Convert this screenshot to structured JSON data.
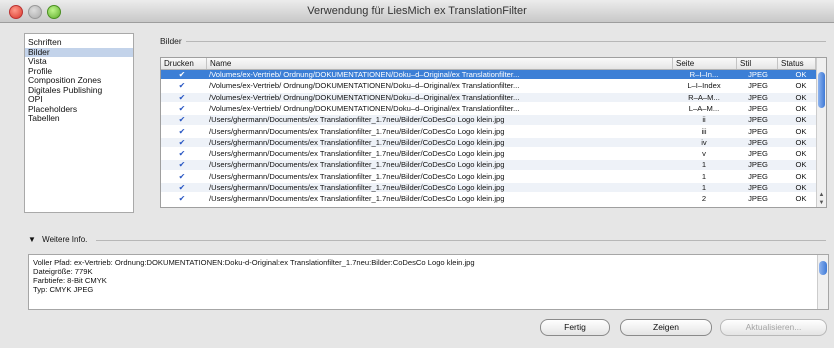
{
  "window": {
    "title": "Verwendung für LiesMich ex TranslationFilter"
  },
  "sidebar": {
    "items": [
      "Schriften",
      "Bilder",
      "Vista",
      "Profile",
      "Composition Zones",
      "Digitales Publishing",
      "OPI",
      "Placeholders",
      "Tabellen"
    ],
    "selected_index": 1
  },
  "images_section": {
    "label": "Bilder"
  },
  "table": {
    "columns": {
      "print": "Drucken",
      "name": "Name",
      "seite": "Seite",
      "stil": "Stil",
      "status": "Status"
    },
    "selected_row": 0,
    "rows": [
      {
        "name": "/Volumes/ex-Vertrieb/  Ordnung/DOKUMENTATIONEN/Doku–d–Original/ex Translationfilter...",
        "seite": "R–I–In...",
        "stil": "JPEG",
        "status": "OK"
      },
      {
        "name": "/Volumes/ex-Vertrieb/  Ordnung/DOKUMENTATIONEN/Doku–d–Original/ex Translationfilter...",
        "seite": "L–I–Index",
        "stil": "JPEG",
        "status": "OK"
      },
      {
        "name": "/Volumes/ex-Vertrieb/  Ordnung/DOKUMENTATIONEN/Doku–d–Original/ex Translationfilter...",
        "seite": "R–A–M...",
        "stil": "JPEG",
        "status": "OK"
      },
      {
        "name": "/Volumes/ex-Vertrieb/  Ordnung/DOKUMENTATIONEN/Doku–d–Original/ex Translationfilter...",
        "seite": "L–A–M...",
        "stil": "JPEG",
        "status": "OK"
      },
      {
        "name": "/Users/ghermann/Documents/ex Translationfilter_1.7neu/Bilder/CoDesCo Logo klein.jpg",
        "seite": "ii",
        "stil": "JPEG",
        "status": "OK"
      },
      {
        "name": "/Users/ghermann/Documents/ex Translationfilter_1.7neu/Bilder/CoDesCo Logo klein.jpg",
        "seite": "iii",
        "stil": "JPEG",
        "status": "OK"
      },
      {
        "name": "/Users/ghermann/Documents/ex Translationfilter_1.7neu/Bilder/CoDesCo Logo klein.jpg",
        "seite": "iv",
        "stil": "JPEG",
        "status": "OK"
      },
      {
        "name": "/Users/ghermann/Documents/ex Translationfilter_1.7neu/Bilder/CoDesCo Logo klein.jpg",
        "seite": "v",
        "stil": "JPEG",
        "status": "OK"
      },
      {
        "name": "/Users/ghermann/Documents/ex Translationfilter_1.7neu/Bilder/CoDesCo Logo klein.jpg",
        "seite": "1",
        "stil": "JPEG",
        "status": "OK"
      },
      {
        "name": "/Users/ghermann/Documents/ex Translationfilter_1.7neu/Bilder/CoDesCo Logo klein.jpg",
        "seite": "1",
        "stil": "JPEG",
        "status": "OK"
      },
      {
        "name": "/Users/ghermann/Documents/ex Translationfilter_1.7neu/Bilder/CoDesCo Logo klein.jpg",
        "seite": "1",
        "stil": "JPEG",
        "status": "OK"
      },
      {
        "name": "/Users/ghermann/Documents/ex Translationfilter_1.7neu/Bilder/CoDesCo Logo klein.jpg",
        "seite": "2",
        "stil": "JPEG",
        "status": "OK"
      }
    ]
  },
  "more_info": {
    "label": "Weitere Info.",
    "lines": [
      "Voller Pfad: ex-Vertrieb:  Ordnung:DOKUMENTATIONEN:Doku-d-Original:ex Translationfilter_1.7neu:Bilder:CoDesCo Logo klein.jpg",
      "Dateigröße: 779K",
      "Farbtiefe: 8-Bit CMYK",
      "Typ: CMYK JPEG"
    ]
  },
  "buttons": {
    "done": "Fertig",
    "show": "Zeigen",
    "update": "Aktualisieren..."
  },
  "colors": {
    "selection": "#3c7fd6",
    "sidebar_selection": "#c3d3ea"
  }
}
